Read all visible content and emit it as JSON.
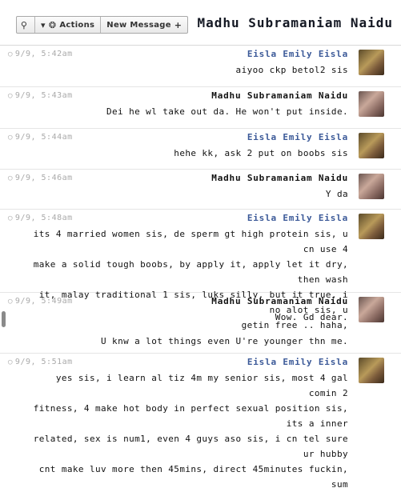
{
  "header": {
    "title": "Madhu Subramaniam Naidu",
    "new_message_label": "New Message",
    "actions_label": "Actions"
  },
  "messages": [
    {
      "sender": "Eisla Emily Eisla",
      "time": "9/9, 5:42am",
      "lines": [
        "aiyoo ckp betol2 sis"
      ]
    },
    {
      "sender": "Madhu Subramaniam Naidu",
      "time": "9/9, 5:43am",
      "lines": [
        "Dei he wl take out da. He won't put inside."
      ]
    },
    {
      "sender": "Eisla Emily Eisla",
      "time": "9/9, 5:44am",
      "lines": [
        "hehe kk, ask 2 put on boobs sis"
      ]
    },
    {
      "sender": "Madhu Subramaniam Naidu",
      "time": "9/9, 5:46am",
      "lines": [
        "Y da"
      ]
    },
    {
      "sender": "Eisla Emily Eisla",
      "time": "9/9, 5:48am",
      "lines": [
        "its 4 married women sis, de sperm gt high protein sis, u cn use 4",
        "make a solid tough boobs, by apply it, apply let it dry, then wash",
        "it, malay traditional 1 sis, luks silly, but it true, i no alot sis, u",
        "getin free .. haha,"
      ]
    },
    {
      "sender": "Madhu Subramaniam Naidu",
      "time": "9/9, 5:49am",
      "lines": [
        "Wow. Gd dear.",
        "",
        "U knw a lot things even U're younger thn me."
      ]
    },
    {
      "sender": "Eisla Emily Eisla",
      "time": "9/9, 5:51am",
      "lines": [
        "yes sis, i learn al tiz 4m my senior sis, most 4 gal comin 2",
        "fitness, 4 make hot body in perfect sexual position sis, its a inner",
        "related, sex is num1, even 4 guys aso sis, i cn tel sure ur hubby",
        "cnt make luv more then 45mins, direct 45minutes fuckin, sum"
      ]
    }
  ]
}
